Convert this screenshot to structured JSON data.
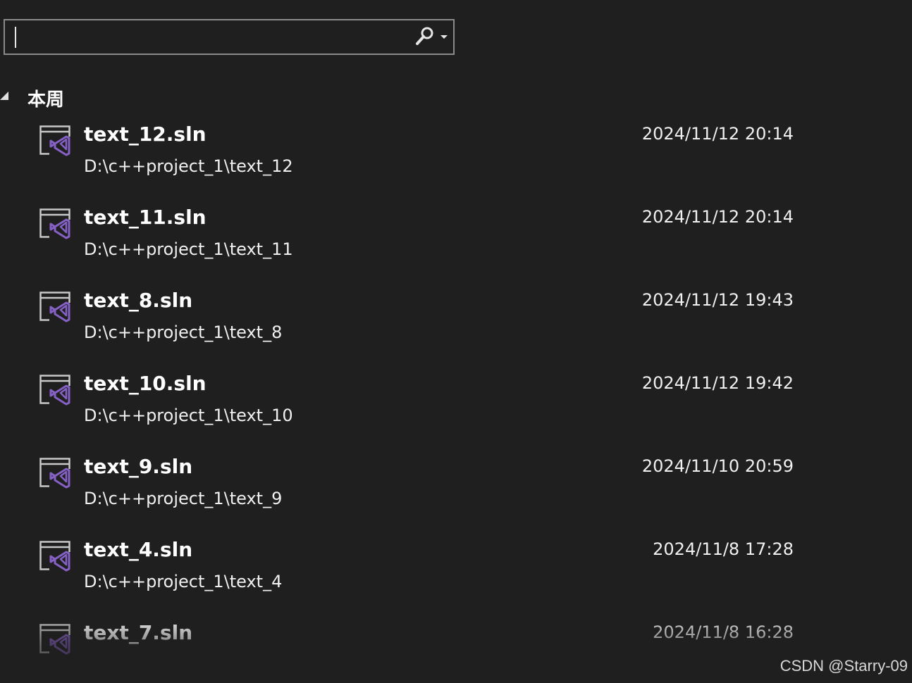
{
  "search": {
    "value": "",
    "placeholder": ""
  },
  "icons": {
    "search_button": "search-icon",
    "dropdown": "chevron-down-icon",
    "group_toggle": "collapse-triangle-icon",
    "item": "visual-studio-solution-icon"
  },
  "colors": {
    "background": "#1f1f1f",
    "accent": "#8661c5"
  },
  "group": {
    "label": "本周"
  },
  "items": [
    {
      "name": "text_12.sln",
      "path": "D:\\c++project_1\\text_12",
      "date": "2024/11/12 20:14"
    },
    {
      "name": "text_11.sln",
      "path": "D:\\c++project_1\\text_11",
      "date": "2024/11/12 20:14"
    },
    {
      "name": "text_8.sln",
      "path": "D:\\c++project_1\\text_8",
      "date": "2024/11/12 19:43"
    },
    {
      "name": "text_10.sln",
      "path": "D:\\c++project_1\\text_10",
      "date": "2024/11/12 19:42"
    },
    {
      "name": "text_9.sln",
      "path": "D:\\c++project_1\\text_9",
      "date": "2024/11/10 20:59"
    },
    {
      "name": "text_4.sln",
      "path": "D:\\c++project_1\\text_4",
      "date": "2024/11/8 17:28"
    },
    {
      "name": "text_7.sln",
      "path": "",
      "date": "2024/11/8 16:28"
    }
  ],
  "watermark": "CSDN @Starry-09"
}
